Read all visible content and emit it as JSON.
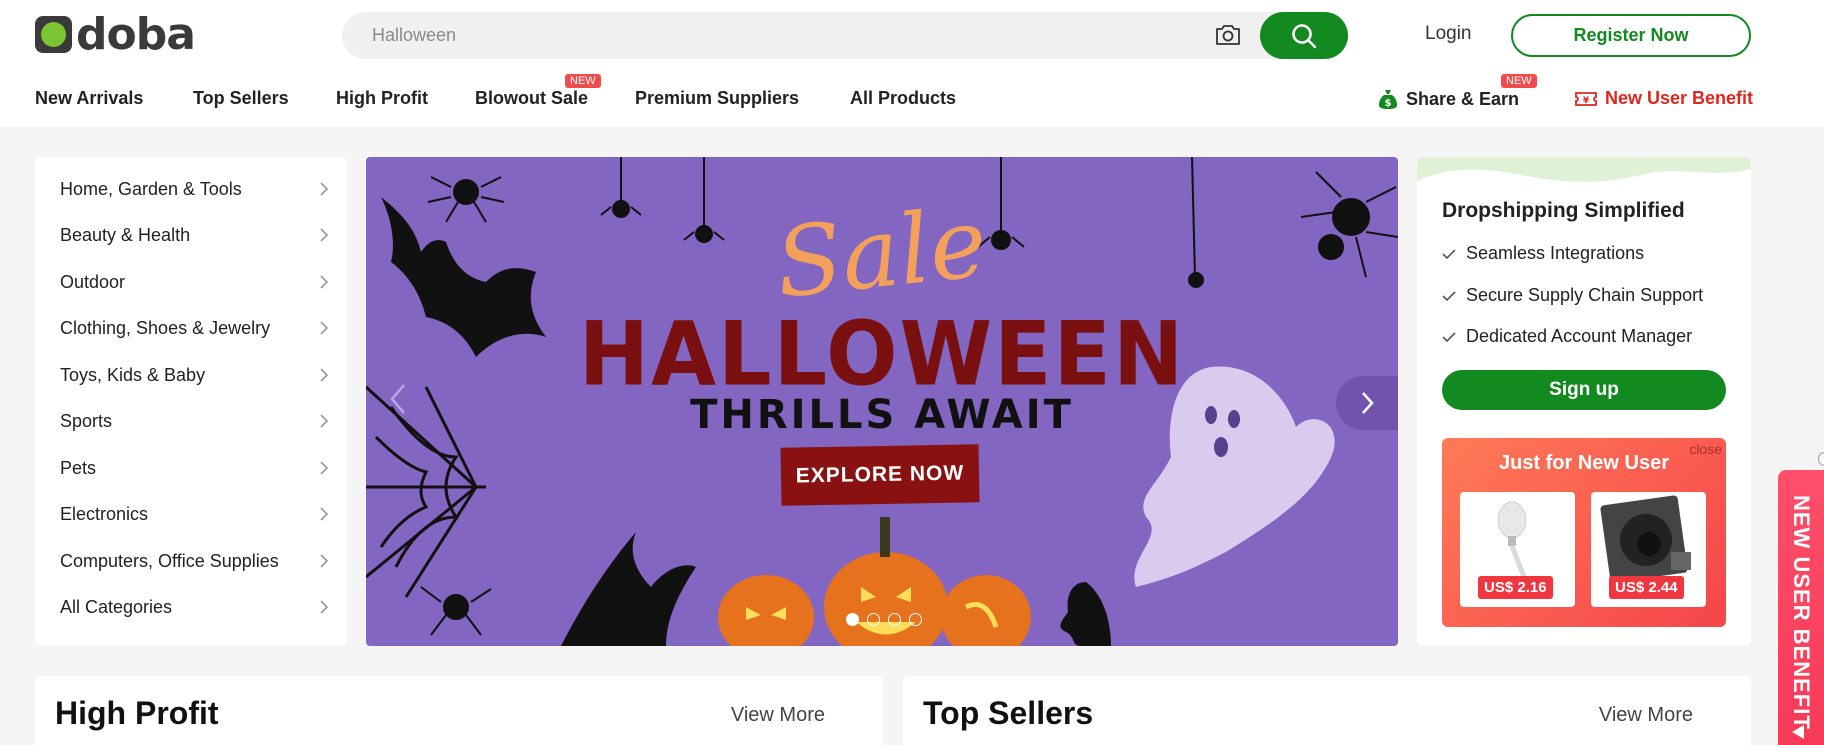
{
  "brand": {
    "name": "doba"
  },
  "search": {
    "placeholder": "Halloween"
  },
  "header": {
    "login": "Login",
    "register": "Register Now"
  },
  "nav": {
    "items": [
      {
        "label": "New Arrivals"
      },
      {
        "label": "Top Sellers"
      },
      {
        "label": "High Profit"
      },
      {
        "label": "Blowout Sale",
        "badge": "NEW"
      },
      {
        "label": "Premium Suppliers"
      },
      {
        "label": "All Products"
      }
    ],
    "share_earn": "Share & Earn",
    "share_badge": "NEW",
    "new_user_benefit": "New User Benefit"
  },
  "categories": [
    "Home, Garden & Tools",
    "Beauty & Health",
    "Outdoor",
    "Clothing, Shoes & Jewelry",
    "Toys, Kids & Baby",
    "Sports",
    "Pets",
    "Electronics",
    "Computers, Office Supplies",
    "All Categories"
  ],
  "banner": {
    "sale": "Sale",
    "headline": "HALLOWEEN",
    "subhead": "THRILLS AWAIT",
    "cta": "EXPLORE NOW"
  },
  "side": {
    "title": "Dropshipping Simplified",
    "features": [
      "Seamless Integrations",
      "Secure Supply Chain Support",
      "Dedicated Account Manager"
    ],
    "signup": "Sign up",
    "promo": {
      "title": "Just for New User",
      "close": "close",
      "products": [
        {
          "price": "US$ 2.16"
        },
        {
          "price": "US$ 2.44"
        }
      ]
    }
  },
  "sections": {
    "high_profit": {
      "title": "High Profit",
      "more": "View More"
    },
    "top_sellers": {
      "title": "Top Sellers",
      "more": "View More"
    }
  },
  "float_tab": {
    "label": "NEW USER BENEFIT"
  },
  "colors": {
    "brand_green": "#128a20",
    "accent_red": "#e0261d",
    "banner_purple": "#8365c2"
  }
}
